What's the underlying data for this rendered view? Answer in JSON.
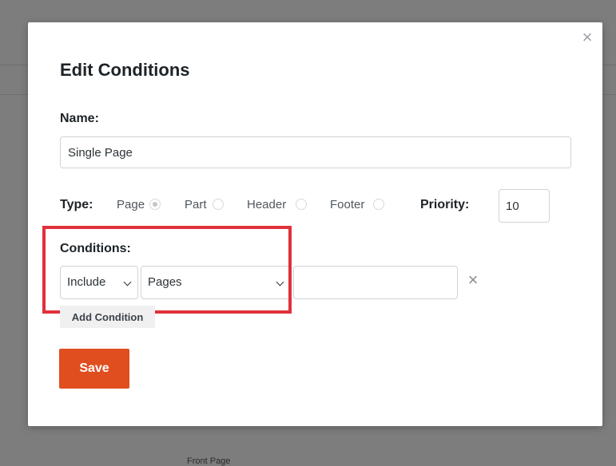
{
  "background": {
    "peek_text": "Front Page"
  },
  "modal": {
    "title": "Edit Conditions",
    "close_icon": "close-icon"
  },
  "name": {
    "label": "Name:",
    "value": "Single Page"
  },
  "type": {
    "label": "Type:",
    "options": [
      {
        "label": "Page",
        "checked": true
      },
      {
        "label": "Part",
        "checked": false
      },
      {
        "label": "Header",
        "checked": false
      },
      {
        "label": "Footer",
        "checked": false
      }
    ]
  },
  "priority": {
    "label": "Priority:",
    "value": "10"
  },
  "conditions": {
    "label": "Conditions:",
    "rule_select": "Include",
    "target_select": "Pages",
    "value": "",
    "remove_icon": "close-icon",
    "add_label": "Add Condition"
  },
  "save_label": "Save",
  "colors": {
    "accent": "#e04e20",
    "highlight": "#e0313a",
    "overlay": "#7d7d7d"
  }
}
